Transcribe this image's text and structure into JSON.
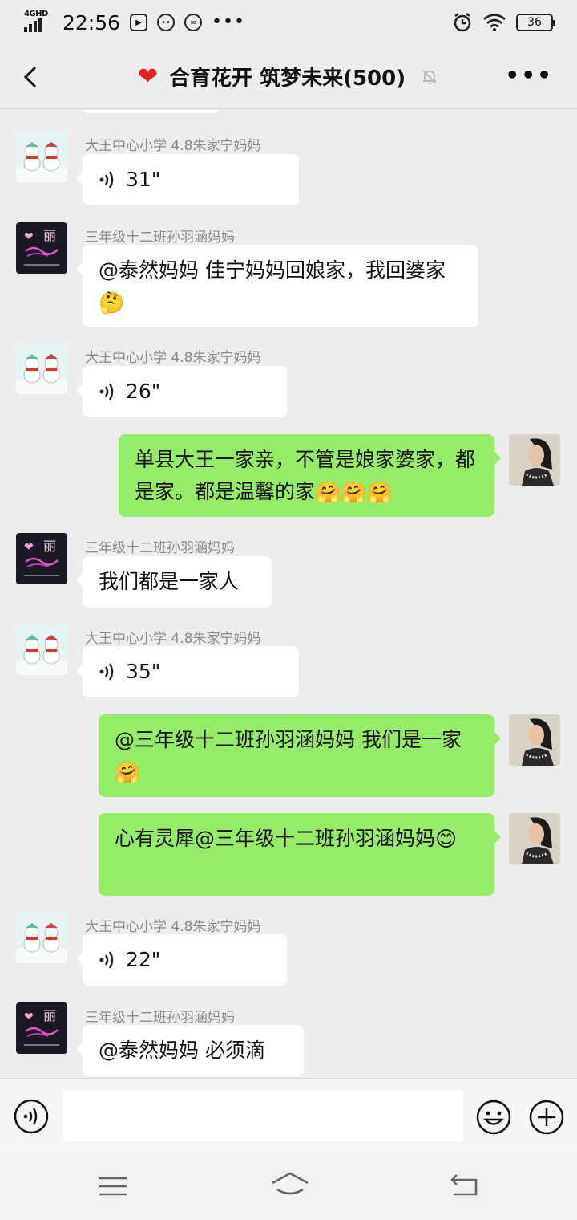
{
  "status_bar": {
    "network": "4GHD",
    "time": "22:56",
    "battery": "36",
    "icons": [
      "play-icon",
      "robot-icon",
      "wechat-icon",
      "more-dots-icon",
      "alarm-icon",
      "wifi-icon",
      "battery-icon"
    ]
  },
  "header": {
    "title": "合育花开 筑梦未来(500)",
    "title_icon": "heart",
    "muted_icon": "bell-off-icon",
    "more_icon": "more-dots-icon",
    "back_icon": "chevron-left-icon"
  },
  "messages": [
    {
      "side": "left",
      "sender": "大王中心小学 4.8朱家宁妈妈",
      "type": "voice",
      "duration": "31\""
    },
    {
      "side": "left",
      "sender": "三年级十二班孙羽涵妈妈",
      "type": "text",
      "text": "@泰然妈妈  佳宁妈妈回娘家，我回婆家",
      "emoji": "🤔"
    },
    {
      "side": "left",
      "sender": "大王中心小学 4.8朱家宁妈妈",
      "type": "voice",
      "duration": "26\""
    },
    {
      "side": "right",
      "type": "text",
      "text": "单县大王一家亲，不管是娘家婆家，都是家。都是温馨的家",
      "emoji": "🤗🤗🤗"
    },
    {
      "side": "left",
      "sender": "三年级十二班孙羽涵妈妈",
      "type": "text",
      "text": "我们都是一家人"
    },
    {
      "side": "left",
      "sender": "大王中心小学 4.8朱家宁妈妈",
      "type": "voice",
      "duration": "35\""
    },
    {
      "side": "right",
      "type": "text",
      "text": "@三年级十二班孙羽涵妈妈  我们是一家",
      "emoji": "🤗"
    },
    {
      "side": "right",
      "type": "text",
      "text": "心有灵犀@三年级十二班孙羽涵妈妈",
      "emoji": "😊"
    },
    {
      "side": "left",
      "sender": "大王中心小学 4.8朱家宁妈妈",
      "type": "voice",
      "duration": "22\""
    },
    {
      "side": "left",
      "sender": "三年级十二班孙羽涵妈妈",
      "type": "text",
      "text": "@泰然妈妈  必须滴"
    }
  ],
  "input_bar": {
    "voice_icon": "voice-mode-icon",
    "input_value": "",
    "emoji_icon": "emoji-icon",
    "plus_icon": "plus-icon"
  },
  "nav_bar": {
    "icons": [
      "menu-icon",
      "home-icon",
      "back-icon"
    ]
  },
  "colors": {
    "background": "#ededed",
    "own_bubble": "#95ec69",
    "other_bubble": "#ffffff",
    "sender_text": "#8a8a8a"
  }
}
